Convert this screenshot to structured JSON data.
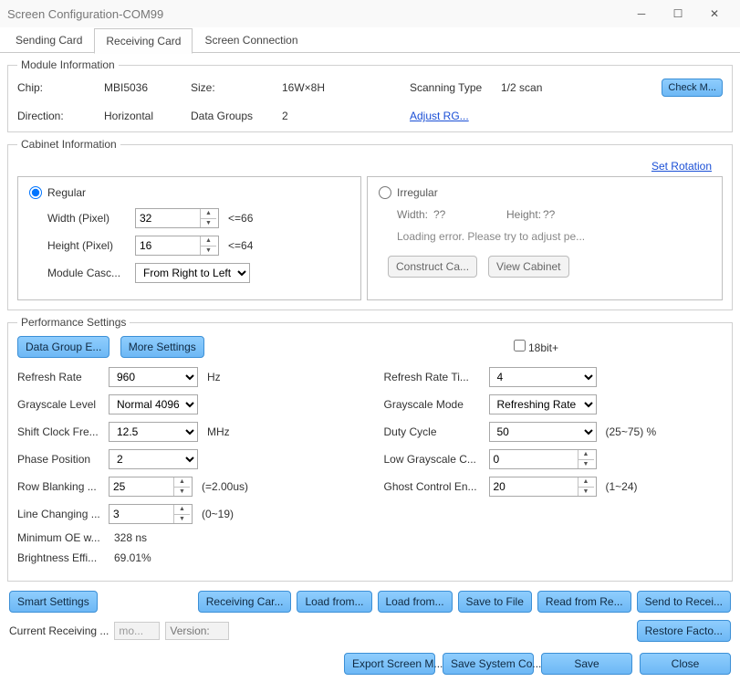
{
  "window": {
    "title": "Screen Configuration-COM99"
  },
  "tabs": {
    "sending": "Sending Card",
    "receiving": "Receiving Card",
    "conn": "Screen Connection",
    "active": "receiving"
  },
  "module": {
    "legend": "Module Information",
    "chip_l": "Chip:",
    "chip_v": "MBI5036",
    "size_l": "Size:",
    "size_v": "16W×8H",
    "scan_l": "Scanning Type",
    "scan_v": "1/2 scan",
    "dir_l": "Direction:",
    "dir_v": "Horizontal",
    "dg_l": "Data Groups",
    "dg_v": "2",
    "adjust": "Adjust RG...",
    "check": "Check M..."
  },
  "cabinet": {
    "legend": "Cabinet Information",
    "set_rotation": "Set Rotation",
    "regular": {
      "label": "Regular",
      "width_l": "Width (Pixel)",
      "width_v": "32",
      "width_hint": "<=66",
      "height_l": "Height (Pixel)",
      "height_v": "16",
      "height_hint": "<=64",
      "casc_l": "Module Casc...",
      "casc_v": "From Right to Left"
    },
    "irregular": {
      "label": "Irregular",
      "width_l": "Width:",
      "width_v": "??",
      "height_l": "Height:",
      "height_v": "??",
      "err": "Loading error. Please try to adjust pe...",
      "construct": "Construct Ca...",
      "view": "View Cabinet"
    }
  },
  "perf": {
    "legend": "Performance Settings",
    "dgex": "Data Group E...",
    "more": "More Settings",
    "bit18": "18bit+",
    "refresh_l": "Refresh Rate",
    "refresh_v": "960",
    "refresh_u": "Hz",
    "gray_l": "Grayscale Level",
    "gray_v": "Normal 4096",
    "shift_l": "Shift Clock Fre...",
    "shift_v": "12.5",
    "shift_u": "MHz",
    "phase_l": "Phase Position",
    "phase_v": "2",
    "rowblank_l": "Row Blanking ...",
    "rowblank_v": "25",
    "rowblank_hint": "(=2.00us)",
    "linech_l": "Line Changing ...",
    "linech_v": "3",
    "linech_hint": "(0~19)",
    "minoe_l": "Minimum OE w...",
    "minoe_v": "328 ns",
    "bright_l": "Brightness Effi...",
    "bright_v": "69.01%",
    "rrt_l": "Refresh Rate Ti...",
    "rrt_v": "4",
    "gmode_l": "Grayscale Mode",
    "gmode_v": "Refreshing Rate Pri",
    "duty_l": "Duty Cycle",
    "duty_v": "50",
    "duty_hint": "(25~75) %",
    "lowg_l": "Low Grayscale C...",
    "lowg_v": "0",
    "ghost_l": "Ghost Control En...",
    "ghost_v": "20",
    "ghost_hint": "(1~24)"
  },
  "actions": {
    "smart": "Smart Settings",
    "recv": "Receiving Car...",
    "load1": "Load from...",
    "load2": "Load from...",
    "savef": "Save to File",
    "readr": "Read from Re...",
    "sendr": "Send to Recei...",
    "current_l": "Current Receiving ...",
    "mo": "mo...",
    "version_l": "Version:",
    "restore": "Restore Facto...",
    "export": "Export Screen M...",
    "savesys": "Save System Co...",
    "save": "Save",
    "close": "Close"
  }
}
